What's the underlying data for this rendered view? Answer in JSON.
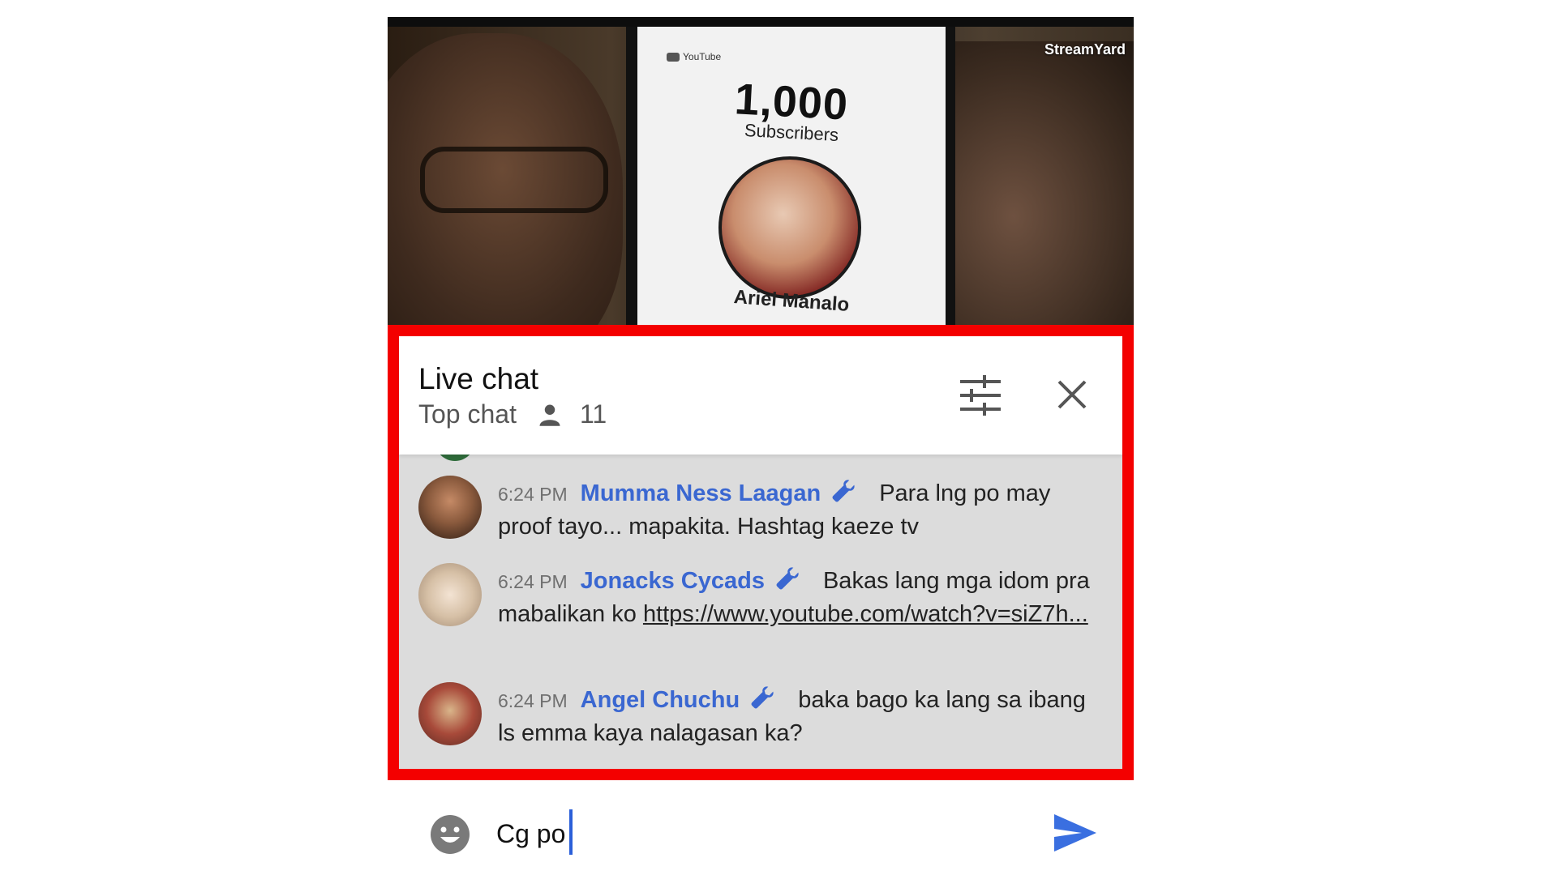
{
  "video": {
    "watermark": "StreamYard",
    "screen_brand": "YouTube",
    "screen_count": "1,000",
    "screen_label": "Subscribers",
    "screen_name": "Ariel Manalo"
  },
  "chat": {
    "title": "Live chat",
    "mode": "Top chat",
    "viewer_count": "11",
    "icons": {
      "viewers": "person-icon",
      "filter": "tune-icon",
      "close": "close-icon",
      "moderator": "wrench-icon"
    },
    "messages": [
      {
        "time": "6:24 PM",
        "author": "Mumma Ness Laagan",
        "text": "Para lng po may proof tayo... mapakita. Hashtag kaeze tv",
        "link": ""
      },
      {
        "time": "6:24 PM",
        "author": "Jonacks Cycads",
        "text": "Bakas lang mga idom pra mabalikan ko",
        "link": "https://www.youtube.com/watch?v=siZ7h..."
      },
      {
        "time": "6:24 PM",
        "author": "Angel Chuchu",
        "text": "baka bago ka lang sa ibang ls emma kaya nalagasan ka?",
        "link": ""
      }
    ]
  },
  "input": {
    "value": "Cg po",
    "emoji_icon": "emoji-icon",
    "send_icon": "send-icon"
  },
  "colors": {
    "highlight_border": "#f40000",
    "author_blue": "#3a67d1",
    "send_blue": "#3a6fe0"
  }
}
